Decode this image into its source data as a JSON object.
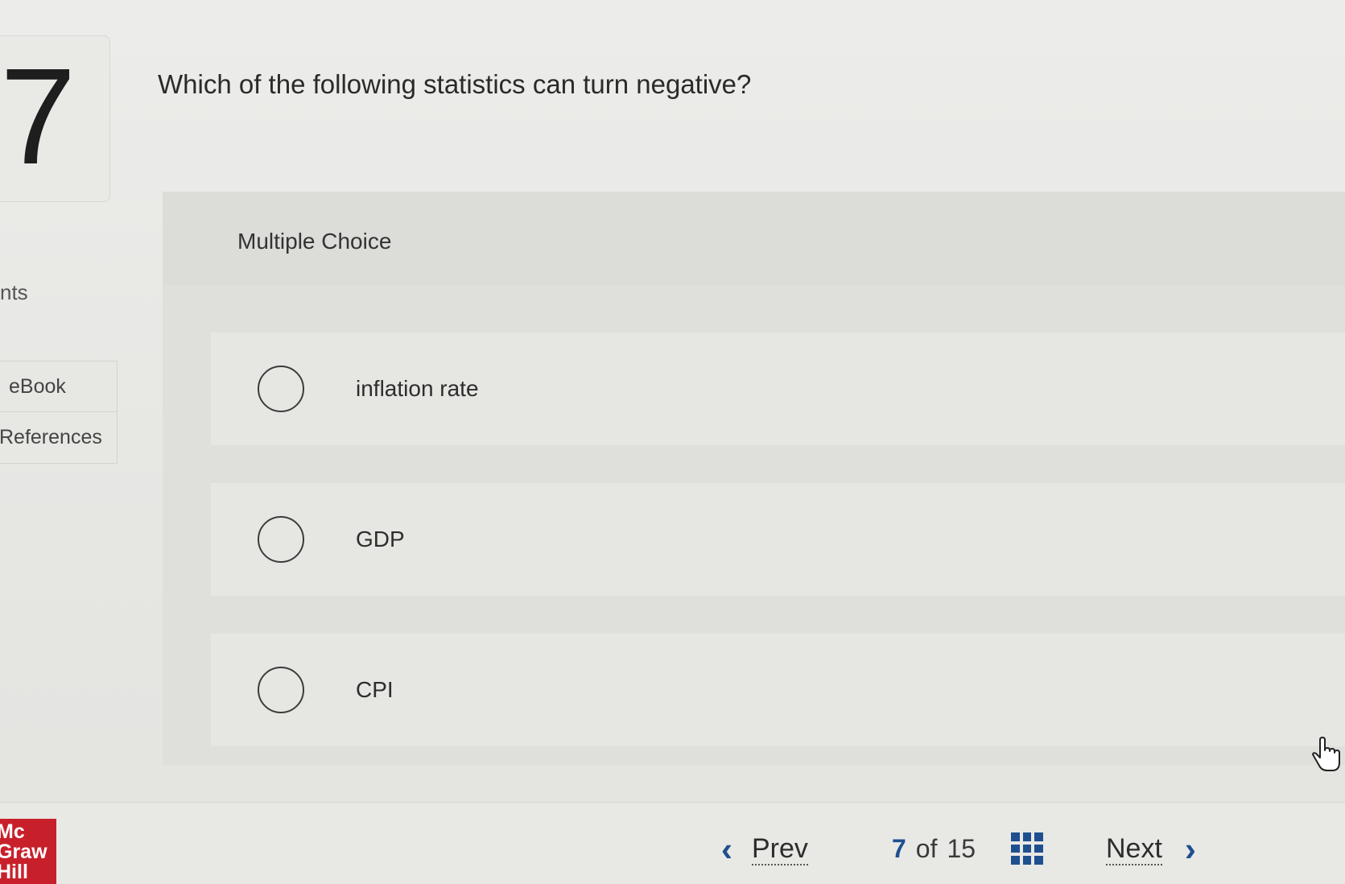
{
  "question": {
    "number": "7",
    "text": "Which of the following statistics can turn negative?",
    "points_label": "nts"
  },
  "side_tabs": {
    "ebook": "eBook",
    "references": "References"
  },
  "multiple_choice": {
    "label": "Multiple Choice",
    "options": [
      {
        "label": "inflation rate"
      },
      {
        "label": "GDP"
      },
      {
        "label": "CPI"
      }
    ]
  },
  "footer": {
    "logo_lines": [
      "Mc",
      "Graw",
      "Hill"
    ],
    "prev_label": "Prev",
    "current_page": "7",
    "of_label": "of",
    "total_pages": "15",
    "next_label": "Next"
  },
  "colors": {
    "accent": "#1f4f8f",
    "logo_red": "#c8202b"
  },
  "icons": {
    "prev": "chevron-left-icon",
    "next": "chevron-right-icon",
    "grid": "grid-icon",
    "cursor": "hand-cursor-icon"
  }
}
